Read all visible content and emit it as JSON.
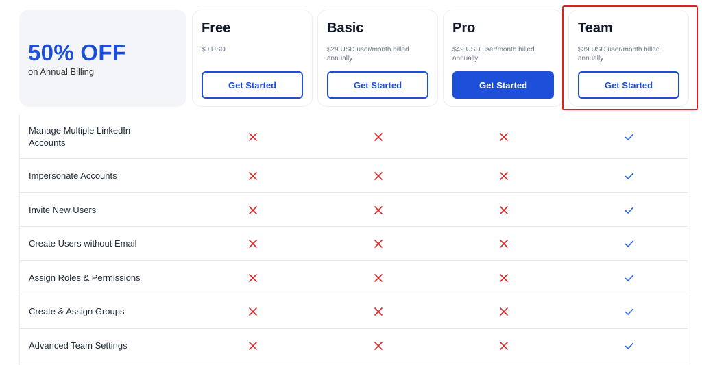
{
  "promo": {
    "headline": "50% OFF",
    "subtext": "on Annual Billing"
  },
  "plans": [
    {
      "name": "Free",
      "price": "$0 USD",
      "cta": "Get Started",
      "cta_style": "outline"
    },
    {
      "name": "Basic",
      "price": "$29 USD user/month billed annually",
      "cta": "Get Started",
      "cta_style": "outline"
    },
    {
      "name": "Pro",
      "price": "$49 USD user/month billed annually",
      "cta": "Get Started",
      "cta_style": "solid"
    },
    {
      "name": "Team",
      "price": "$39 USD user/month billed annually",
      "cta": "Get Started",
      "cta_style": "outline",
      "highlighted": true
    }
  ],
  "features": [
    {
      "label": "Manage Multiple LinkedIn Accounts",
      "availability": [
        false,
        false,
        false,
        true
      ]
    },
    {
      "label": "Impersonate Accounts",
      "availability": [
        false,
        false,
        false,
        true
      ]
    },
    {
      "label": "Invite New Users",
      "availability": [
        false,
        false,
        false,
        true
      ]
    },
    {
      "label": "Create Users without Email",
      "availability": [
        false,
        false,
        false,
        true
      ]
    },
    {
      "label": "Assign Roles & Permissions",
      "availability": [
        false,
        false,
        false,
        true
      ]
    },
    {
      "label": "Create & Assign Groups",
      "availability": [
        false,
        false,
        false,
        true
      ]
    },
    {
      "label": "Advanced Team Settings",
      "availability": [
        false,
        false,
        false,
        true
      ]
    }
  ],
  "icons": {
    "included": "check-icon",
    "excluded": "cross-icon"
  },
  "colors": {
    "brand": "#1d4fd8",
    "cross": "#dc2626",
    "check": "#2563eb",
    "highlight": "#e11d26"
  }
}
